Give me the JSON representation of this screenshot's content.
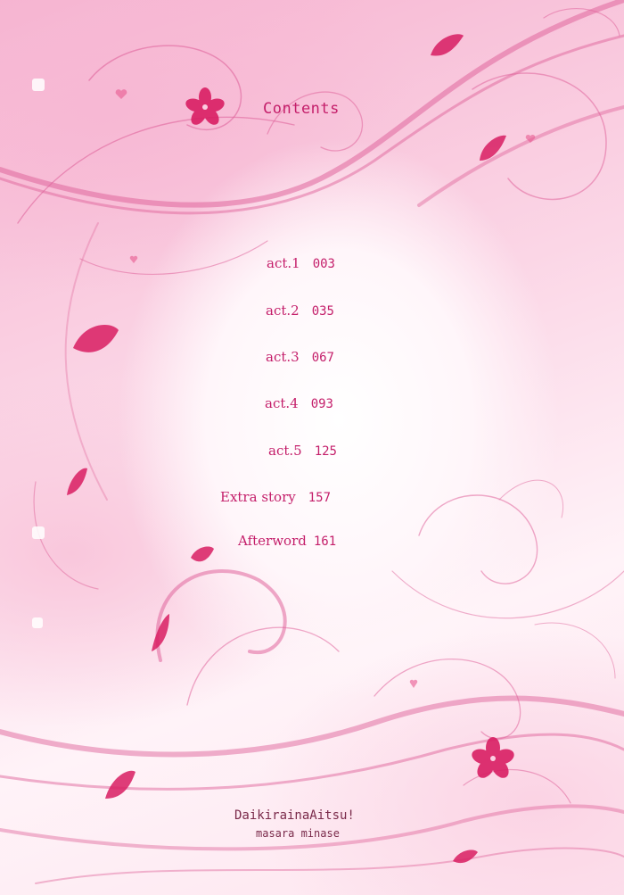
{
  "page": {
    "heading": "Contents",
    "entries": [
      {
        "label": "act.1",
        "page": "003"
      },
      {
        "label": "act.2",
        "page": "035"
      },
      {
        "label": "act.3",
        "page": "067"
      },
      {
        "label": "act.4",
        "page": "093"
      },
      {
        "label": "act.5",
        "page": "125"
      },
      {
        "label": "Extra story",
        "page": "157"
      },
      {
        "label": "Afterword",
        "page": "161"
      }
    ],
    "book_title": "DaikirainaAitsu!",
    "author": "masara minase"
  },
  "colors": {
    "text": "#c41e6a",
    "footer_text": "#7a2a4a",
    "vine": "#e0669c",
    "petal": "#d81d62"
  }
}
